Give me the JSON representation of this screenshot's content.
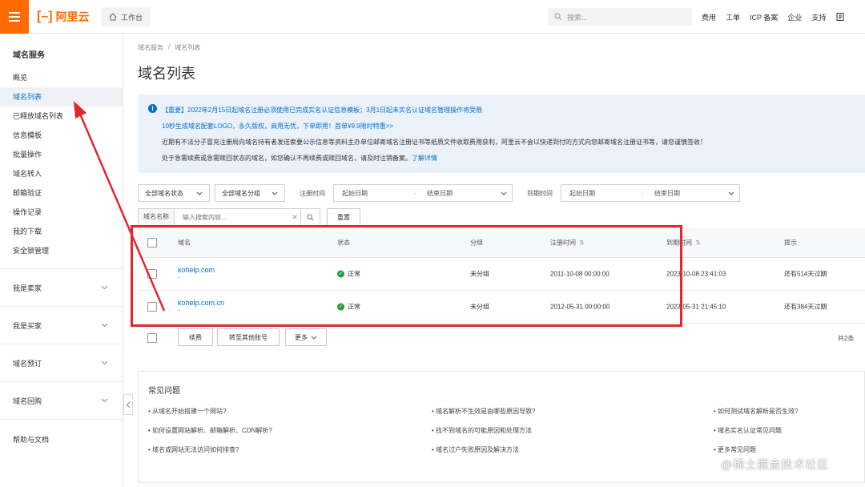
{
  "topbar": {
    "logo_text": "阿里云",
    "workbench": "工作台",
    "search_placeholder": "搜索...",
    "nav": [
      "费用",
      "工单",
      "ICP 备案",
      "企业",
      "支持"
    ]
  },
  "sidebar": {
    "title": "域名服务",
    "items": [
      "概览",
      "域名列表",
      "已释放域名列表",
      "信息模板",
      "批量操作",
      "域名转入",
      "邮箱验证",
      "操作记录",
      "我的下载",
      "安全锁管理"
    ],
    "active_index": 1,
    "groups": [
      "我是卖家",
      "我是买家",
      "域名预订",
      "域名回购"
    ],
    "help": "帮助与文档"
  },
  "breadcrumb": [
    "域名服务",
    "/",
    "域名列表"
  ],
  "page_title": "域名列表",
  "notice": {
    "line1": "【重要】2022年2月15日起域名注册必须使用已完成实名认证信息模板；3月1日起未实名认证域名管理操作将受限",
    "line2": "10秒生成域名配套LOGO，永久版权，商用无忧，下单即用！首单¥9.9限时特惠>>",
    "line3": "近期有不法分子冒充注册局向域名持有者发送索要公示信息等资料主办单位邮寄域名注册证书等纸质文件收取费用获利，阿里云不会以快递到付的方式向您邮寄域名注册证书等，请您谨慎签收！",
    "line4": "处于急需续费或急需赎回状态的域名，如您确认不再续费或赎回域名，请及时注销备案。",
    "link": "了解详情"
  },
  "filters": {
    "status_select": "全部域名状态",
    "group_select": "全部域名分组",
    "reg_label": "注册时间",
    "reg_start": "起始日期",
    "reg_end": "结束日期",
    "exp_label": "到期时间",
    "exp_start": "起始日期",
    "exp_end": "结束日期",
    "name_label": "域名名称",
    "search_placeholder": "输入搜索内容...",
    "reset": "重置"
  },
  "table": {
    "headers": {
      "domain": "域名",
      "status": "状态",
      "group": "分组",
      "reg_time": "注册时间",
      "exp_time": "到期时间",
      "hint": "提示"
    },
    "rows": [
      {
        "domain": "kohelp.com",
        "sub": "-",
        "status": "正常",
        "group": "未分组",
        "reg_time": "2011-10-08 00:00:00",
        "exp_time": "2023-10-08 23:41:03",
        "hint": "还有514天过期"
      },
      {
        "domain": "kohelp.com.cn",
        "sub": "-",
        "status": "正常",
        "group": "未分组",
        "reg_time": "2012-05-31 00:00:00",
        "exp_time": "2023-05-31 21:45:10",
        "hint": "还有384天过期"
      }
    ]
  },
  "bulk": {
    "renew": "续费",
    "transfer": "转至其他账号",
    "more": "更多",
    "total": "共2条"
  },
  "faq": {
    "title": "常见问题",
    "items": [
      "从域名开始搭建一个网站?",
      "域名解析不生效是由哪些原因导致?",
      "如何测试域名解析是否生效?",
      "如何设置网站解析、邮箱解析、CDN解析?",
      "找不到域名的可能原因和处理方法",
      "域名实名认证常见问题",
      "域名或网站无法访问如何排查?",
      "域名过户失败原因及解决方法",
      "更多常见问题"
    ]
  },
  "watermark": "@稀土掘金技术社区",
  "colors": {
    "brand": "#ff6a00",
    "link": "#0070cc",
    "annotation_red": "#e0282e",
    "status_ok": "#1f9c3b"
  }
}
